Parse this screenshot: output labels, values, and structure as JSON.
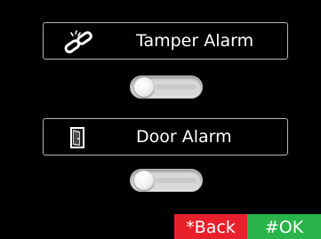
{
  "alarms": {
    "tamper": {
      "label": "Tamper Alarm",
      "icon": "broken-chain-icon",
      "enabled": false
    },
    "door": {
      "label": "Door Alarm",
      "icon": "door-icon",
      "enabled": false
    }
  },
  "softkeys": {
    "back": {
      "label": "*Back",
      "color": "#e8202c"
    },
    "ok": {
      "label": "#OK",
      "color": "#29b34a"
    }
  },
  "colors": {
    "background": "#000000",
    "row_border": "#b5b5b5",
    "text": "#ffffff"
  }
}
